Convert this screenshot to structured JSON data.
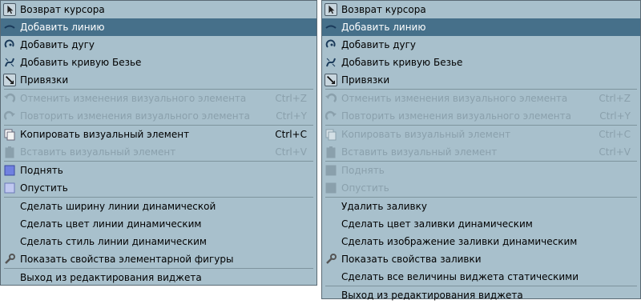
{
  "left_menu": {
    "items": [
      {
        "label": "Возврат курсора",
        "icon": "cursor-icon",
        "state": "normal",
        "type": "item"
      },
      {
        "label": "Добавить линию",
        "icon": "line-icon",
        "state": "highlight",
        "type": "item"
      },
      {
        "label": "Добавить дугу",
        "icon": "arc-icon",
        "state": "normal",
        "type": "item"
      },
      {
        "label": "Добавить кривую Безье",
        "icon": "bezier-icon",
        "state": "normal",
        "type": "item"
      },
      {
        "label": "Привязки",
        "icon": "snap-icon",
        "state": "normal",
        "type": "item"
      },
      {
        "type": "separator"
      },
      {
        "label": "Отменить изменения визуального элемента",
        "shortcut": "Ctrl+Z",
        "icon": "undo-icon",
        "state": "disabled",
        "type": "item"
      },
      {
        "label": "Повторить изменения визуального элемента",
        "shortcut": "Ctrl+Y",
        "icon": "redo-icon",
        "state": "disabled",
        "type": "item"
      },
      {
        "type": "separator"
      },
      {
        "label": "Копировать визуальный элемент",
        "shortcut": "Ctrl+C",
        "icon": "copy-icon",
        "state": "normal",
        "type": "item"
      },
      {
        "label": "Вставить визуальный элемент",
        "shortcut": "Ctrl+V",
        "icon": "paste-icon",
        "state": "disabled",
        "type": "item"
      },
      {
        "type": "separator"
      },
      {
        "label": "Поднять",
        "icon": "raise-icon",
        "state": "normal",
        "type": "item"
      },
      {
        "label": "Опустить",
        "icon": "lower-icon",
        "state": "normal",
        "type": "item"
      },
      {
        "type": "separator"
      },
      {
        "label": "Сделать ширину линии динамической",
        "state": "normal",
        "type": "item"
      },
      {
        "label": "Сделать цвет линии динамическим",
        "state": "normal",
        "type": "item"
      },
      {
        "label": "Сделать стиль линии динамическим",
        "state": "normal",
        "type": "item"
      },
      {
        "label": "Показать свойства элементарной фигуры",
        "icon": "wrench-icon",
        "state": "normal",
        "type": "item"
      },
      {
        "type": "separator"
      },
      {
        "label": "Выход из редактирования виджета",
        "state": "normal",
        "type": "item"
      }
    ]
  },
  "right_menu": {
    "items": [
      {
        "label": "Возврат курсора",
        "icon": "cursor-icon",
        "state": "normal",
        "type": "item"
      },
      {
        "label": "Добавить линию",
        "icon": "line-icon",
        "state": "highlight",
        "type": "item"
      },
      {
        "label": "Добавить дугу",
        "icon": "arc-icon",
        "state": "normal",
        "type": "item"
      },
      {
        "label": "Добавить кривую Безье",
        "icon": "bezier-icon",
        "state": "normal",
        "type": "item"
      },
      {
        "label": "Привязки",
        "icon": "snap-icon",
        "state": "normal",
        "type": "item"
      },
      {
        "type": "separator"
      },
      {
        "label": "Отменить изменения визуального элемента",
        "shortcut": "Ctrl+Z",
        "icon": "undo-icon",
        "state": "disabled",
        "type": "item"
      },
      {
        "label": "Повторить изменения визуального элемента",
        "shortcut": "Ctrl+Y",
        "icon": "redo-icon",
        "state": "disabled",
        "type": "item"
      },
      {
        "type": "separator"
      },
      {
        "label": "Копировать визуальный элемент",
        "shortcut": "Ctrl+C",
        "icon": "copy-icon",
        "state": "disabled",
        "type": "item"
      },
      {
        "label": "Вставить визуальный элемент",
        "shortcut": "Ctrl+V",
        "icon": "paste-icon",
        "state": "disabled",
        "type": "item"
      },
      {
        "type": "separator"
      },
      {
        "label": "Поднять",
        "icon": "raise-icon",
        "state": "disabled",
        "type": "item"
      },
      {
        "label": "Опустить",
        "icon": "lower-icon",
        "state": "disabled",
        "type": "item"
      },
      {
        "type": "separator"
      },
      {
        "label": "Удалить заливку",
        "state": "normal",
        "type": "item"
      },
      {
        "label": "Сделать цвет заливки динамическим",
        "state": "normal",
        "type": "item"
      },
      {
        "label": "Сделать изображение заливки динамическим",
        "state": "normal",
        "type": "item"
      },
      {
        "label": "Показать свойства заливки",
        "icon": "wrench-icon",
        "state": "normal",
        "type": "item"
      },
      {
        "label": "Сделать все величины виджета статическими",
        "state": "normal",
        "type": "item"
      },
      {
        "type": "separator"
      },
      {
        "label": "Выход из редактирования виджета",
        "state": "normal",
        "type": "item"
      }
    ]
  },
  "colors": {
    "menu_bg": "#a8c0cc",
    "highlight_bg": "#46708a",
    "disabled_text": "#8aa0ac"
  }
}
